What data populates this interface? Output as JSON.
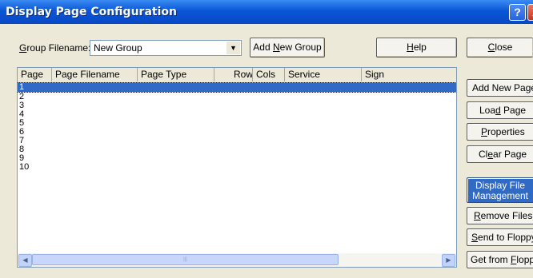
{
  "window": {
    "title": "Display Page Configuration",
    "help_glyph": "?",
    "close_glyph": "X"
  },
  "group": {
    "label_pre": "G",
    "label_u": "",
    "label_post": "roup Filename:",
    "label": "Group Filename:",
    "value": "New Group"
  },
  "buttons": {
    "add_group_pre": "Add ",
    "add_group_u": "N",
    "add_group_post": "ew Group",
    "help_u": "H",
    "help_post": "elp",
    "close_u": "C",
    "close_post": "lose"
  },
  "table": {
    "columns": [
      "Page",
      "Page Filename",
      "Page Type",
      "Rows",
      "Cols",
      "Service",
      "Sign"
    ],
    "rows": [
      "1",
      "2",
      "3",
      "4",
      "5",
      "6",
      "7",
      "8",
      "9",
      "10"
    ],
    "selected": "1"
  },
  "side": {
    "add_page": "Add New Page",
    "load_pre": "Loa",
    "load_u": "d",
    "load_post": " Page",
    "props_u": "P",
    "props_post": "roperties",
    "clear_pre": "Cl",
    "clear_u": "e",
    "clear_post": "ar Page",
    "dfm_line1": "Display File",
    "dfm_line2": "Management",
    "remove_u": "R",
    "remove_post": "emove Files",
    "send_u": "S",
    "send_post": "end to Floppy",
    "get_pre": "Get from ",
    "get_u": "F",
    "get_post": "loppy"
  },
  "colors": {
    "titlebar": "#0a56d6",
    "selection": "#316ac5",
    "face": "#ece9d8"
  }
}
